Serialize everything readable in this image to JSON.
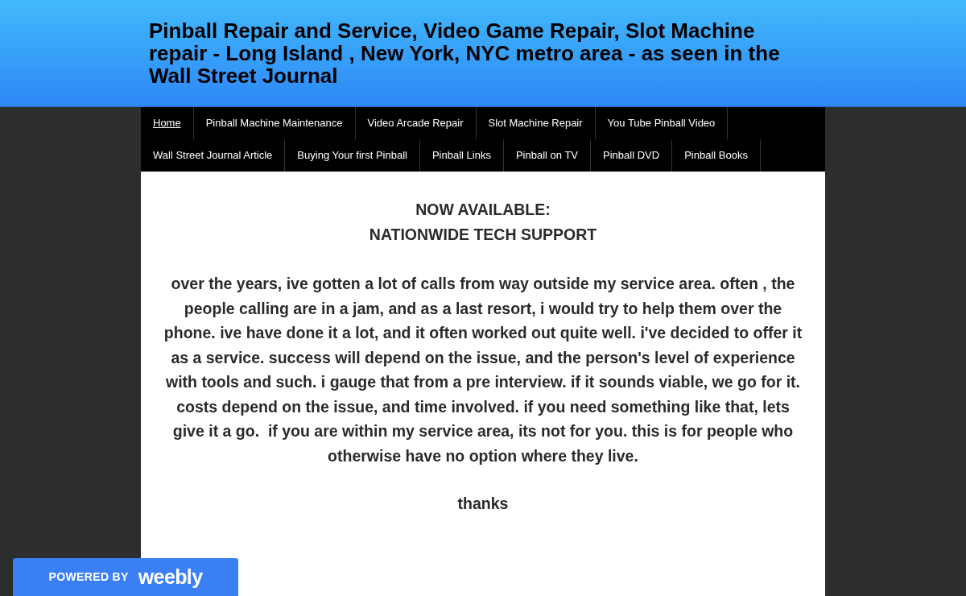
{
  "header": {
    "title": "Pinball Repair and Service, Video Game Repair, Slot Machine repair - Long Island , New York, NYC metro area - as seen in the Wall Street Journal"
  },
  "nav": [
    {
      "label": "Home",
      "selected": true
    },
    {
      "label": "Pinball Machine Maintenance",
      "selected": false
    },
    {
      "label": "Video Arcade Repair",
      "selected": false
    },
    {
      "label": "Slot Machine Repair",
      "selected": false
    },
    {
      "label": "You Tube Pinball Video",
      "selected": false
    },
    {
      "label": "Wall Street Journal Article",
      "selected": false
    },
    {
      "label": "Buying Your first Pinball",
      "selected": false
    },
    {
      "label": "Pinball Links",
      "selected": false
    },
    {
      "label": "Pinball on TV",
      "selected": false
    },
    {
      "label": "Pinball DVD",
      "selected": false
    },
    {
      "label": "Pinball Books",
      "selected": false
    }
  ],
  "content": {
    "headings": [
      "NOW AVAILABLE:",
      "NATIONWIDE TECH SUPPORT"
    ],
    "paragraph": "over the years, ive gotten a lot of calls from way outside my service area. often , the people calling are in a jam, and as a last resort, i would try to help them over the phone. ive have done it a lot, and it often worked out quite well. i've decided to offer it as a service. success will depend on the issue, and the person's level of experience with tools and such. i gauge that from a pre interview. if it sounds viable, we go for it.  costs depend on the issue, and time involved. if you need something like that, lets give it a go.  if you are within my service area, its not for you. this is for people who otherwise have no option where they live.",
    "signoff": "thanks"
  },
  "badge": {
    "prefix": "POWERED BY",
    "brand": "weebly"
  }
}
